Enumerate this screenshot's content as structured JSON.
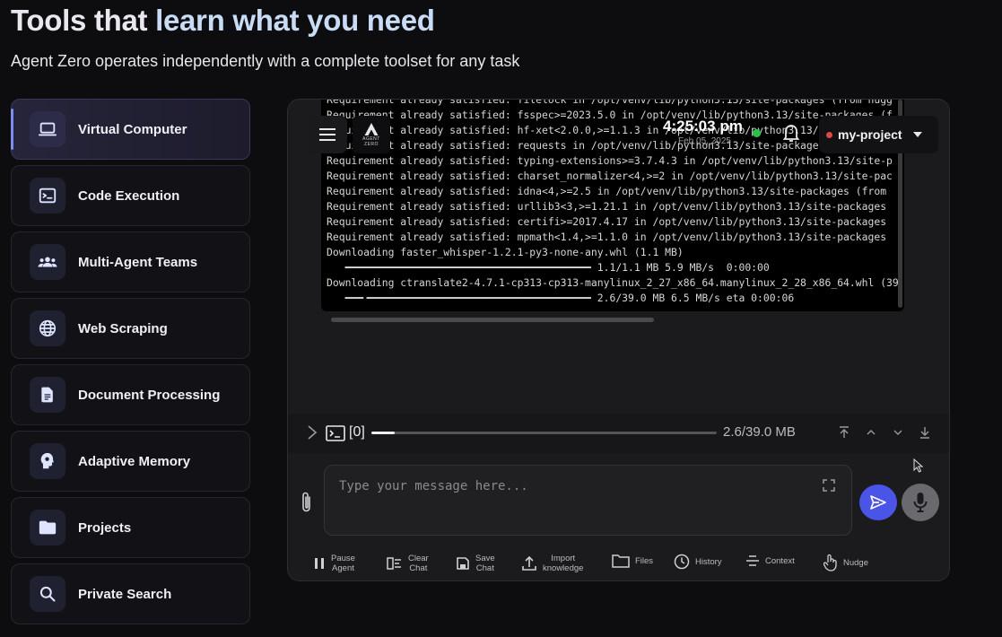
{
  "hero": {
    "title_plain": "Tools that ",
    "title_accent": "learn what you need",
    "subtitle": "Agent Zero operates independently with a complete toolset for any task"
  },
  "features": [
    {
      "label": "Virtual Computer",
      "icon": "laptop-icon",
      "active": true
    },
    {
      "label": "Code Execution",
      "icon": "terminal-icon",
      "active": false
    },
    {
      "label": "Multi-Agent Teams",
      "icon": "group-icon",
      "active": false
    },
    {
      "label": "Web Scraping",
      "icon": "globe-icon",
      "active": false
    },
    {
      "label": "Document Processing",
      "icon": "document-icon",
      "active": false
    },
    {
      "label": "Adaptive Memory",
      "icon": "brain-icon",
      "active": false
    },
    {
      "label": "Projects",
      "icon": "folder-icon",
      "active": false
    },
    {
      "label": "Private Search",
      "icon": "search-icon",
      "active": false
    }
  ],
  "app": {
    "logo_text": [
      "AGENT",
      "ZERO"
    ],
    "clock": "4:25:03 pm",
    "date": "Feb 05, 2025",
    "project": "my-project",
    "terminal_lines": [
      "Requirement already satisfied: filelock in /opt/venv/lib/python3.13/site-packages (from hugg",
      "Requirement already satisfied: fsspec>=2023.5.0 in /opt/venv/lib/python3.13/site-packages (f",
      "Requirement already satisfied: hf-xet<2.0.0,>=1.1.3 in /opt/venv/lib/python3.13/site-packages",
      "Requirement already satisfied: requests in /opt/venv/lib/python3.13/site-packages",
      "Requirement already satisfied: typing-extensions>=3.7.4.3 in /opt/venv/lib/python3.13/site-p",
      "Requirement already satisfied: charset_normalizer<4,>=2 in /opt/venv/lib/python3.13/site-pac",
      "Requirement already satisfied: idna<4,>=2.5 in /opt/venv/lib/python3.13/site-packages (from",
      "Requirement already satisfied: urllib3<3,>=1.21.1 in /opt/venv/lib/python3.13/site-packages",
      "Requirement already satisfied: certifi>=2017.4.17 in /opt/venv/lib/python3.13/site-packages",
      "Requirement already satisfied: mpmath<1.4,>=1.1.0 in /opt/venv/lib/python3.13/site-packages",
      "Downloading faster_whisper-1.2.1-py3-none-any.whl (1.1 MB)",
      "   ━━━━━━━━━━━━━━━━━━━━━━━━━━━━━━━━━━━━━━━━ 1.1/1.1 MB 5.9 MB/s  0:00:00",
      "Downloading ctranslate2-4.7.1-cp313-cp313-manylinux_2_27_x86_64.manylinux_2_28_x86_64.whl (39.",
      "   ━━━╺━━━━━━━━━━━━━━━━━━━━━━━━━━━━━━━━━━━━ 2.6/39.0 MB 6.5 MB/s eta 0:00:06"
    ],
    "progress": {
      "index": "[0]",
      "fraction": 0.067,
      "size": "2.6/39.0 MB"
    },
    "input_placeholder": "Type your message here...",
    "tools": [
      {
        "label": "Pause\nAgent",
        "icon": "pause-icon"
      },
      {
        "label": "Clear\nChat",
        "icon": "clear-chat-icon"
      },
      {
        "label": "Save\nChat",
        "icon": "save-icon"
      },
      {
        "label": "Import\nknowledge",
        "icon": "upload-icon"
      },
      {
        "label": "Files",
        "icon": "folder-icon"
      },
      {
        "label": "History",
        "icon": "history-icon"
      },
      {
        "label": "Context",
        "icon": "context-icon"
      },
      {
        "label": "Nudge",
        "icon": "hand-icon"
      }
    ]
  },
  "colors": {
    "accent": "#c8dcf6",
    "send_button": "#4a55e8",
    "status_online": "#27c24c",
    "project_dot": "#e04848"
  }
}
